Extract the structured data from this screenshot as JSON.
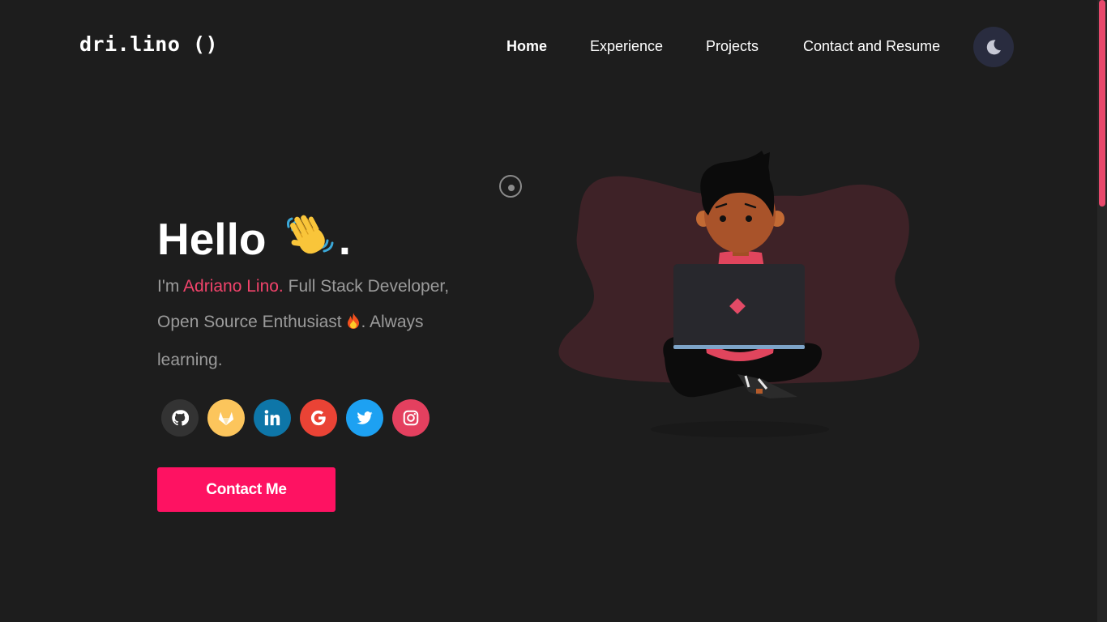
{
  "header": {
    "logo": "dri.lino ()",
    "nav": [
      {
        "label": "Home",
        "active": true
      },
      {
        "label": "Experience",
        "active": false
      },
      {
        "label": "Projects",
        "active": false
      },
      {
        "label": "Contact and Resume",
        "active": false
      }
    ],
    "theme_toggle_icon": "moon-icon"
  },
  "hero": {
    "greeting": "Hello",
    "greeting_emoji_icon": "waving-hand-icon",
    "greeting_punct": ".",
    "intro_prefix": "I'm ",
    "name": "Adriano Lino.",
    "intro_rest": " Full Stack Developer, Open Source Enthusiast ",
    "fire_icon": "fire-icon",
    "intro_end": ". Always learning.",
    "cta_label": "Contact Me"
  },
  "socials": [
    {
      "name": "github",
      "icon": "github-icon",
      "color": "#333333"
    },
    {
      "name": "gitlab",
      "icon": "gitlab-icon",
      "color": "#fcc55c"
    },
    {
      "name": "linkedin",
      "icon": "linkedin-icon",
      "color": "#0e76a8"
    },
    {
      "name": "google",
      "icon": "google-icon",
      "color": "#ea4335"
    },
    {
      "name": "twitter",
      "icon": "twitter-icon",
      "color": "#1da1f2"
    },
    {
      "name": "instagram",
      "icon": "instagram-icon",
      "color": "#e4405f"
    }
  ],
  "colors": {
    "background": "#1d1d1d",
    "accent": "#f2436b",
    "button": "#fe1262",
    "muted_text": "#9b9b9b",
    "toggle_bg": "#292c3f"
  }
}
